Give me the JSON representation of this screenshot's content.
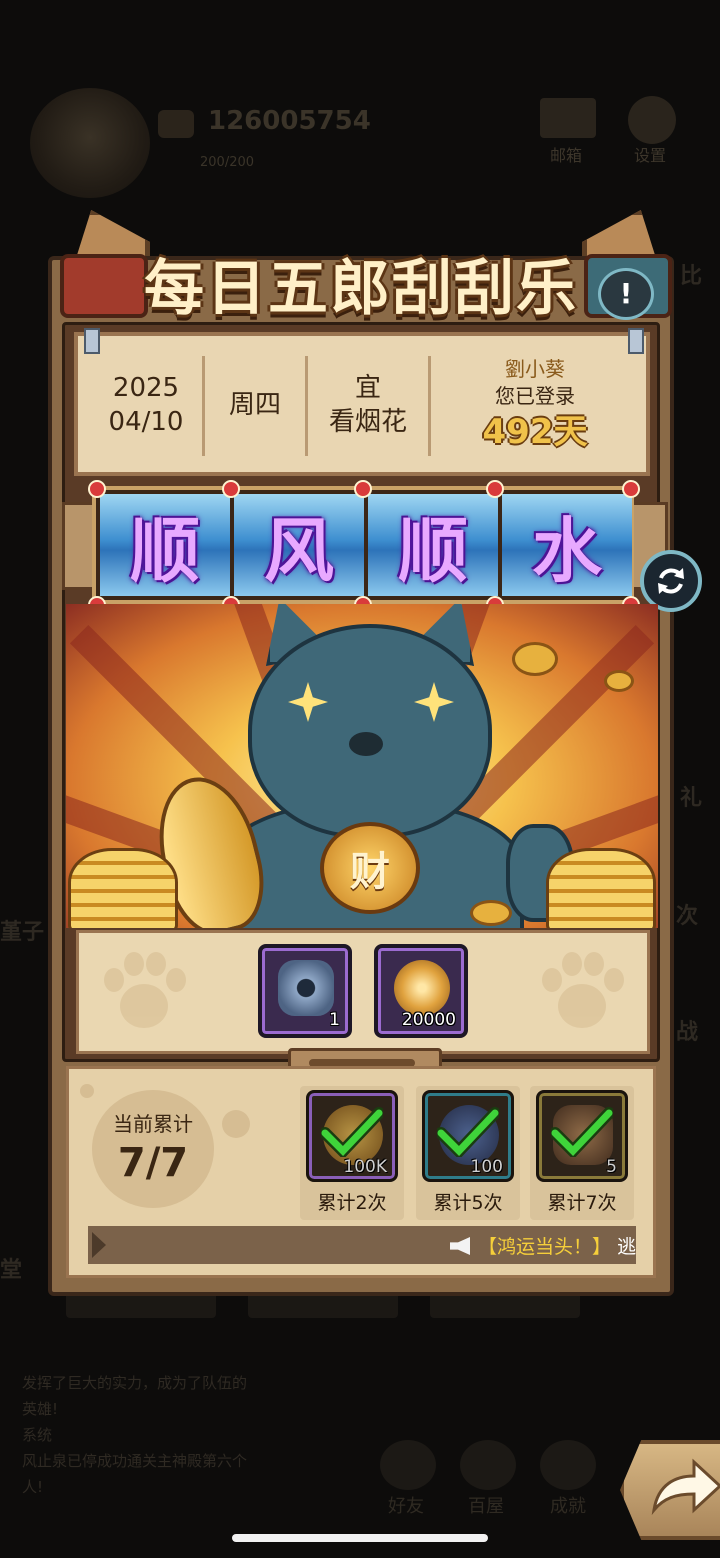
{
  "background": {
    "player_id": "126005754",
    "energy": "200/200",
    "mail_label": "邮箱",
    "settings_label": "设置",
    "chat_lines": [
      "发挥了巨大的实力，成为了队伍的",
      "英雄!",
      "系统",
      "风止泉已停成功通关主神殿第六个",
      "人!"
    ],
    "nav_labels": [
      "好友",
      "百屋",
      "成就"
    ],
    "side_labels": [
      "比",
      "礼",
      "堇子",
      "堂",
      "次",
      "战"
    ]
  },
  "dialog": {
    "title": "每日五郎刮刮乐",
    "info_icon": "!",
    "date": {
      "year": "2025",
      "monthday": "04/10"
    },
    "weekday": "周四",
    "fortune": {
      "label": "宜",
      "activity": "看烟花"
    },
    "login": {
      "name": "劉小葵",
      "message": "您已登录",
      "days": "492天"
    },
    "reels": [
      "顺",
      "风",
      "顺",
      "水"
    ],
    "refresh_icon": "refresh-icon",
    "collar_char": "财",
    "rewards": [
      {
        "icon": "gear-fragment-icon",
        "count": "1"
      },
      {
        "icon": "gold-medal-icon",
        "count": "20000"
      }
    ],
    "progress": {
      "label": "当前累计",
      "value": "7/7"
    },
    "milestones": [
      {
        "icon": "gold-coin-icon",
        "count": "100K",
        "label": "累计2次",
        "claimed": true
      },
      {
        "icon": "blue-crystal-icon",
        "count": "100",
        "label": "累计5次",
        "claimed": true
      },
      {
        "icon": "bronze-vase-icon",
        "count": "5",
        "label": "累计7次",
        "claimed": true
      }
    ],
    "marquee": {
      "highlight": "【鸿运当头！】",
      "text": "逃避的贝吕"
    }
  },
  "colors": {
    "reel_text": "#e8a9ff",
    "title_text": "#fff0c8",
    "check": "#3fd43a",
    "marquee_highlight": "#f6cf3a"
  }
}
